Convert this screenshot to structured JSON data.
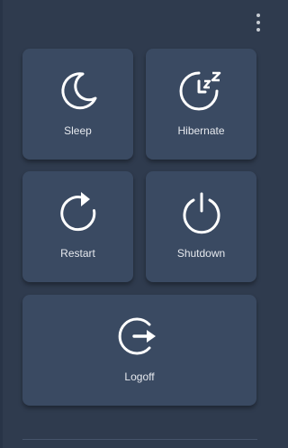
{
  "accent": "#ffffff",
  "menu": {
    "icon": "more-vert-icon"
  },
  "actions": {
    "sleep": {
      "label": "Sleep",
      "icon": "moon-icon"
    },
    "hibernate": {
      "label": "Hibernate",
      "icon": "hibernate-clock-icon"
    },
    "restart": {
      "label": "Restart",
      "icon": "restart-icon"
    },
    "shutdown": {
      "label": "Shutdown",
      "icon": "power-icon"
    },
    "logoff": {
      "label": "Logoff",
      "icon": "logoff-icon"
    }
  }
}
